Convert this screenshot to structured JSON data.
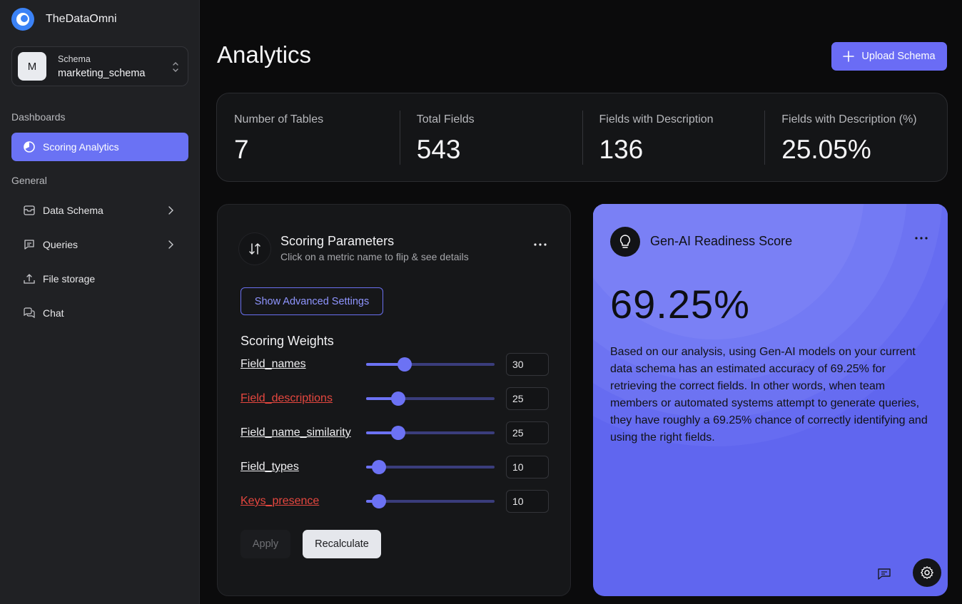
{
  "app": {
    "name": "TheDataOmni"
  },
  "schema": {
    "label": "Schema",
    "avatar": "M",
    "value": "marketing_schema"
  },
  "sidebar": {
    "dashboards_label": "Dashboards",
    "active_item": {
      "label": "Scoring Analytics",
      "icon": "pie-chart-icon"
    },
    "general_label": "General",
    "items": [
      {
        "label": "Data Schema",
        "icon": "inbox-icon",
        "has_chevron": true
      },
      {
        "label": "Queries",
        "icon": "message-square-icon",
        "has_chevron": true
      },
      {
        "label": "File storage",
        "icon": "upload-icon",
        "has_chevron": false
      },
      {
        "label": "Chat",
        "icon": "chat-bubbles-icon",
        "has_chevron": false
      }
    ]
  },
  "header": {
    "title": "Analytics",
    "upload_label": "Upload Schema"
  },
  "stats": [
    {
      "label": "Number of Tables",
      "value": "7"
    },
    {
      "label": "Total Fields",
      "value": "543"
    },
    {
      "label": "Fields with Description",
      "value": "136"
    },
    {
      "label": "Fields with Description (%)",
      "value": "25.05%"
    }
  ],
  "params": {
    "title": "Scoring Parameters",
    "subtitle": "Click on a metric name to flip & see details",
    "advanced_label": "Show Advanced Settings",
    "weights_title": "Scoring Weights",
    "weights": [
      {
        "name": "Field_names",
        "value": "30",
        "level": 0.3,
        "highlight": false
      },
      {
        "name": "Field_descriptions",
        "value": "25",
        "level": 0.25,
        "highlight": true
      },
      {
        "name": "Field_name_similarity",
        "value": "25",
        "level": 0.25,
        "highlight": false
      },
      {
        "name": "Field_types",
        "value": "10",
        "level": 0.1,
        "highlight": false
      },
      {
        "name": "Keys_presence",
        "value": "10",
        "level": 0.1,
        "highlight": true
      }
    ],
    "apply_label": "Apply",
    "recalculate_label": "Recalculate"
  },
  "readiness": {
    "title": "Gen-AI Readiness Score",
    "score": "69.25%",
    "description": "Based on our analysis, using Gen-AI models on your current data schema has an estimated accuracy of 69.25% for retrieving the correct fields. In other words, when team members or automated systems attempt to generate queries, they have roughly a 69.25% chance of correctly identifying and using the right fields."
  },
  "colors": {
    "accent": "#6a6cf5",
    "card_score_bg": "#6066ef",
    "highlight_red": "#e5473f"
  }
}
